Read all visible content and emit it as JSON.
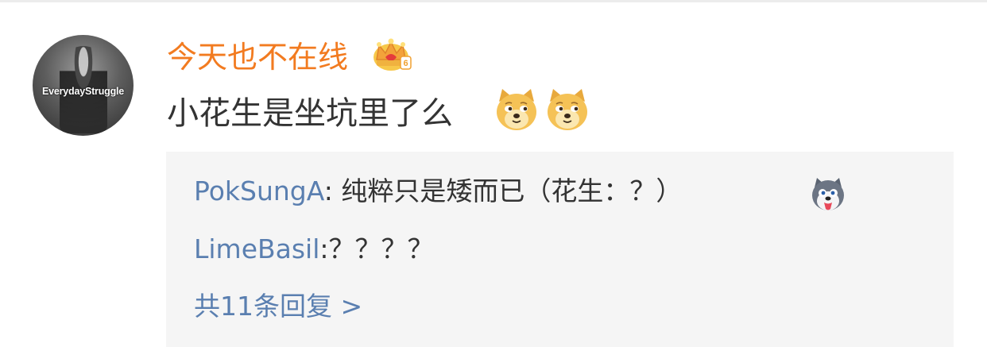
{
  "comment": {
    "avatar_text": "EverydayStruggle",
    "username": "今天也不在线",
    "badge_icon": "crown-icon",
    "text": "小花生是坐坑里了么",
    "emojis": [
      "doge-icon",
      "doge-icon"
    ]
  },
  "replies": [
    {
      "author": "PokSungA",
      "separator": ": ",
      "text": "纯粹只是矮而已（花生：？）",
      "emoji": "husky-icon"
    },
    {
      "author": "LimeBasil",
      "separator": ":",
      "text": "？？？？"
    }
  ],
  "more_replies": "共11条回复 >",
  "colors": {
    "username": "#f27b20",
    "reply_author": "#5a7fb0",
    "reply_bg": "#f5f5f5",
    "text": "#333333"
  }
}
